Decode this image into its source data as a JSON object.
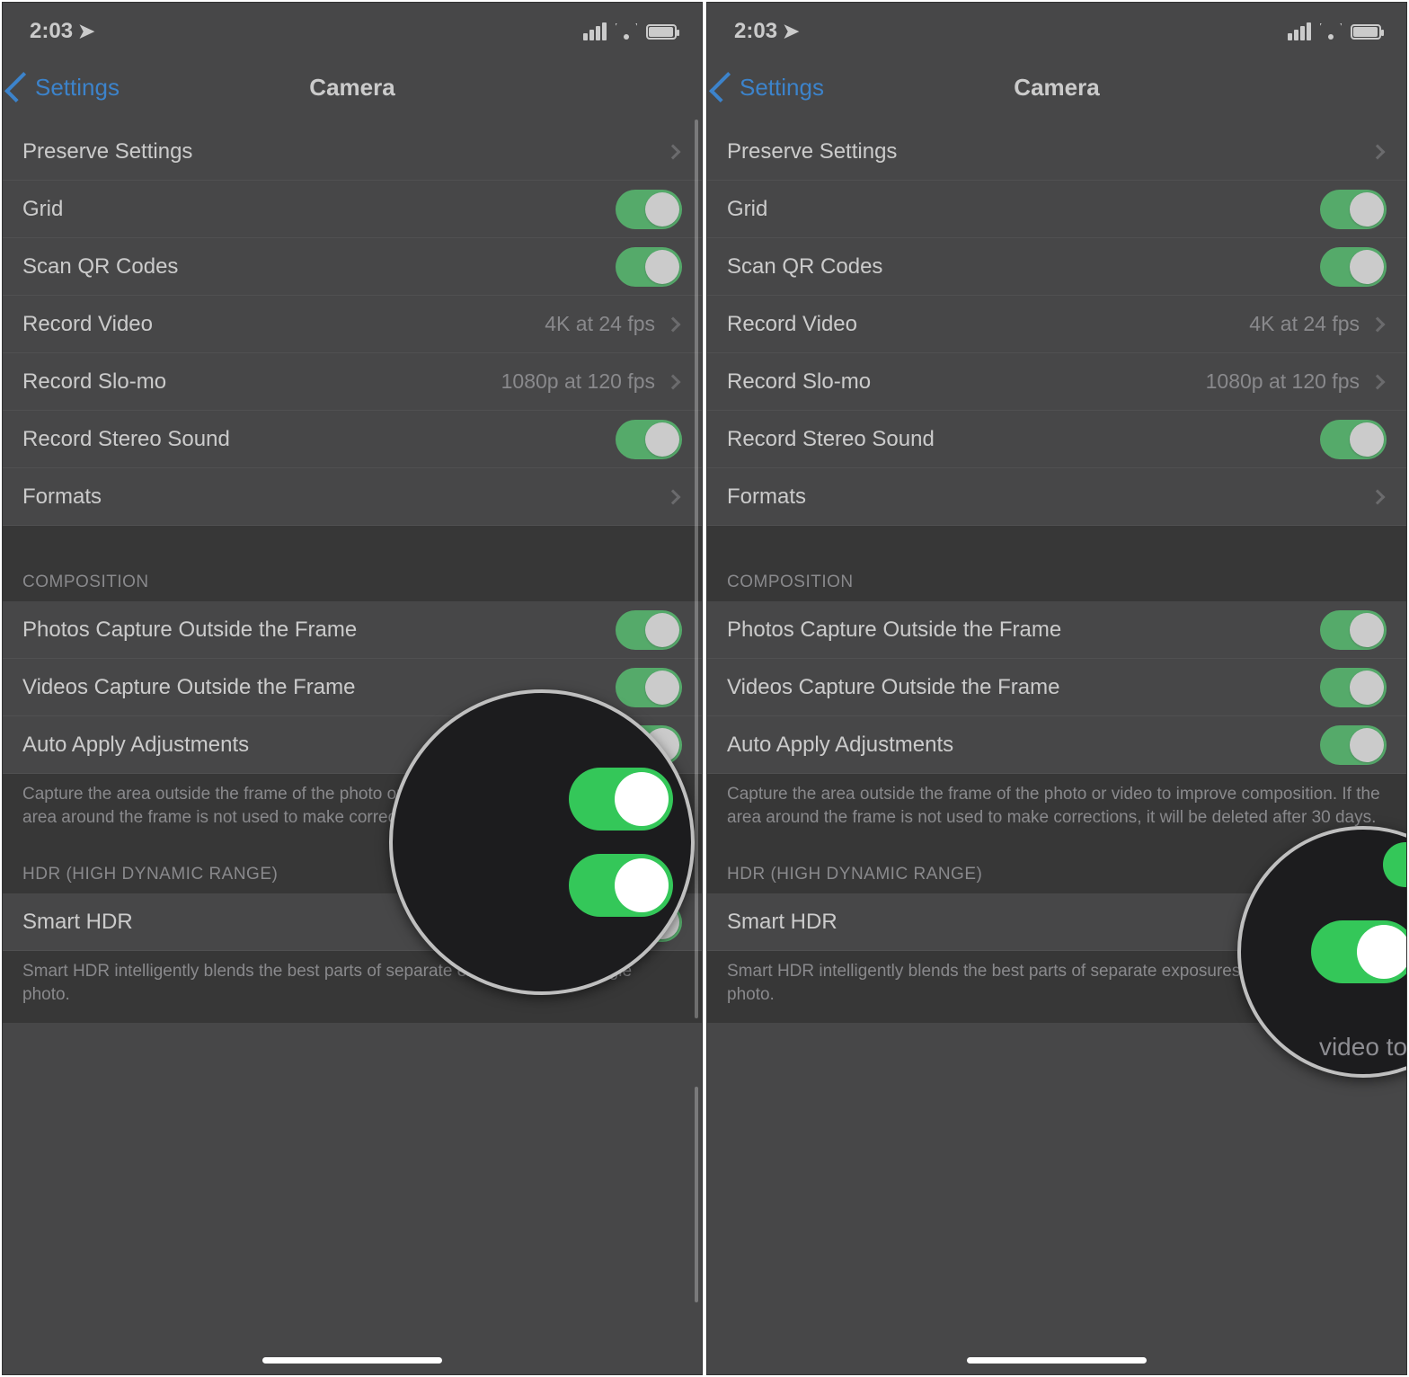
{
  "status": {
    "time": "2:03"
  },
  "nav": {
    "back": "Settings",
    "title": "Camera"
  },
  "rows": {
    "preserve": "Preserve Settings",
    "grid": "Grid",
    "qr": "Scan QR Codes",
    "recVideo": "Record Video",
    "recVideoVal": "4K at 24 fps",
    "recSlomo": "Record Slo-mo",
    "recSlomoVal": "1080p at 120 fps",
    "stereo": "Record Stereo Sound",
    "formats": "Formats",
    "photosOutside": "Photos Capture Outside the Frame",
    "videosOutside": "Videos Capture Outside the Frame",
    "autoApply": "Auto Apply Adjustments",
    "smartHdr": "Smart HDR"
  },
  "sections": {
    "composition": "COMPOSITION",
    "compositionFooter": "Capture the area outside the frame of the photo or video to improve composition. If the area around the frame is not used to make corrections, it will be deleted after 30 days.",
    "hdr": "HDR (HIGH DYNAMIC RANGE)",
    "hdrFooter": "Smart HDR intelligently blends the best parts of separate exposures into a single photo."
  },
  "magnifier2Text": "video to"
}
